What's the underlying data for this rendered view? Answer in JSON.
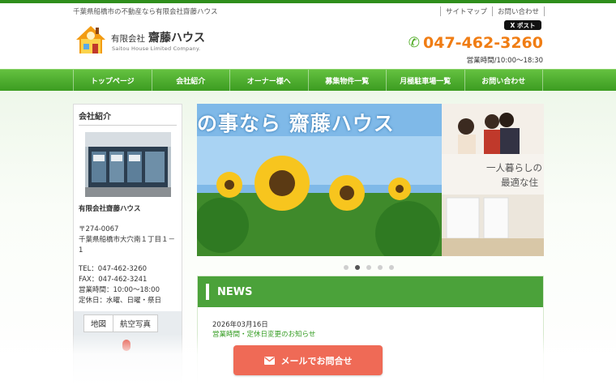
{
  "header": {
    "tagline": "千葉県船橋市の不動産なら有限会社齋藤ハウス",
    "links": [
      "サイトマップ",
      "お問い合わせ"
    ],
    "x_post_label": "X ポスト",
    "logo_prefix": "有限会社",
    "logo_name": "齋藤ハウス",
    "logo_en": "Saitou House Limited Company.",
    "phone": "047-462-3260",
    "hours": "営業時間/10:00～18:30",
    "phone_icon": "phone-icon"
  },
  "nav": {
    "items": [
      "トップページ",
      "会社紹介",
      "オーナー様へ",
      "募集物件一覧",
      "月極駐車場一覧",
      "お問い合わせ"
    ]
  },
  "sidebar": {
    "title": "会社紹介",
    "company": "有限会社齋藤ハウス",
    "address_lines": [
      "〒274-0067",
      "千葉県船橋市大穴南１丁目１－",
      "1"
    ],
    "contact_lines": [
      "TEL：047-462-3260",
      "FAX：047-462-3241",
      "営業時間：10:00～18:00",
      "定休日：水曜、日曜・祭日"
    ],
    "map_tabs": [
      "地図",
      "航空写真"
    ]
  },
  "banner": {
    "caption": "の事なら 齋藤ハウス",
    "side_text_lines": [
      "一人暮らしの",
      "最適な住"
    ],
    "dots_total": 5,
    "dots_active": 1
  },
  "news": {
    "heading": "NEWS",
    "date": "2026年03月16日",
    "title": "営業時間・定休日変更のお知らせ"
  },
  "cta": {
    "mail_label": "メールでお問合せ"
  }
}
